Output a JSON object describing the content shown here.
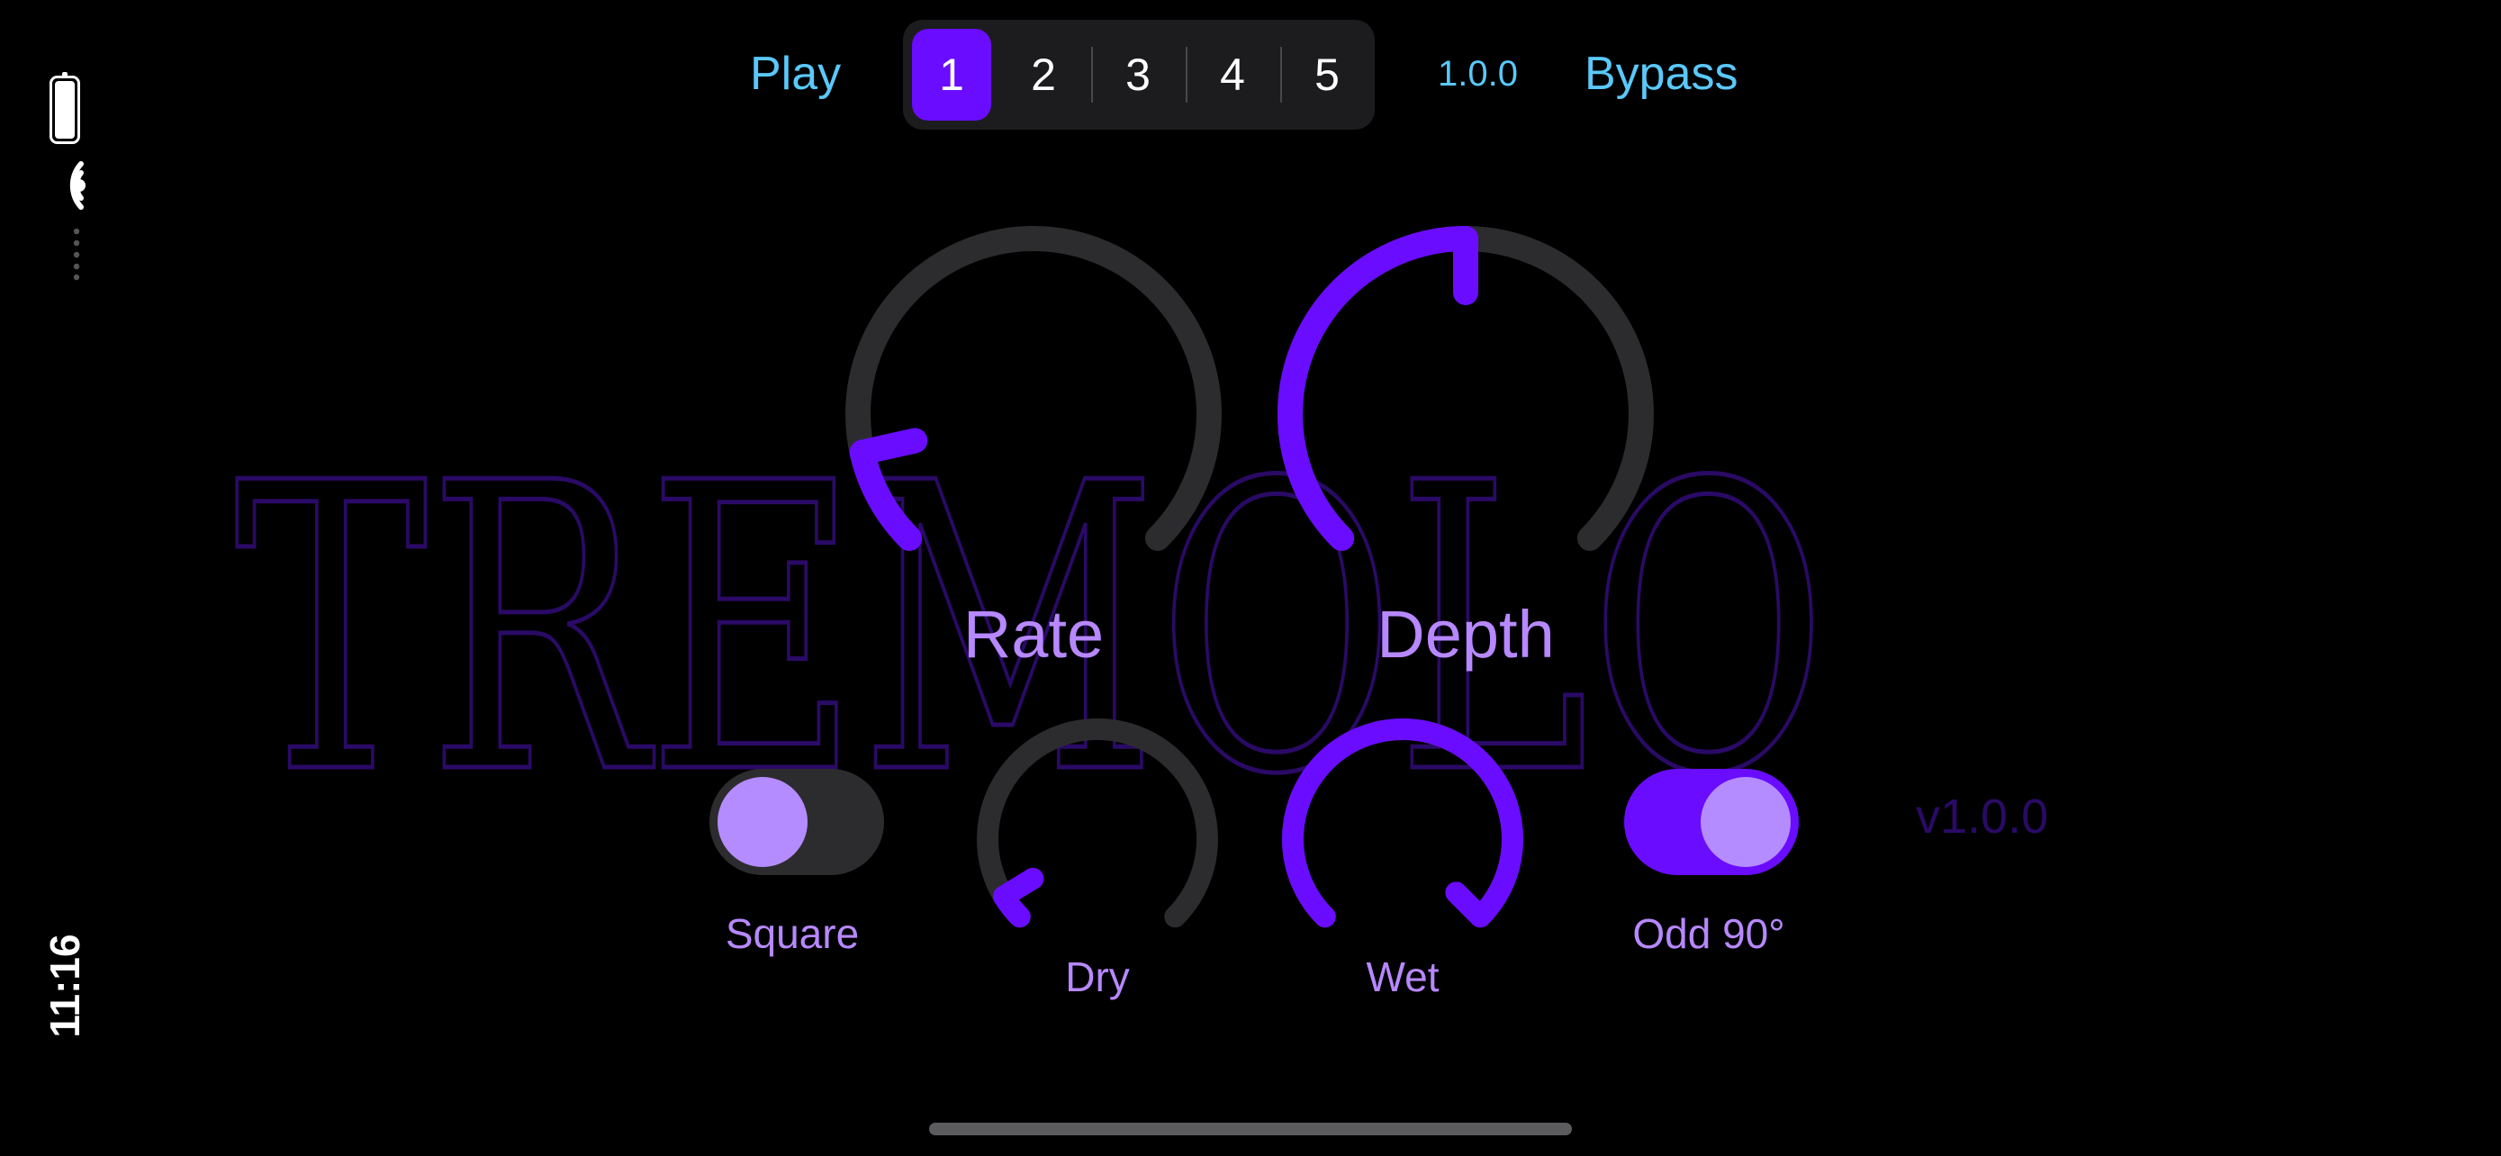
{
  "status_bar": {
    "time": "11:16",
    "battery_icon": "battery-icon",
    "wifi_icon": "wifi-icon"
  },
  "header": {
    "play_label": "Play",
    "bypass_label": "Bypass",
    "version": "1.0.0",
    "presets": [
      {
        "label": "1",
        "selected": true
      },
      {
        "label": "2",
        "selected": false
      },
      {
        "label": "3",
        "selected": false
      },
      {
        "label": "4",
        "selected": false
      },
      {
        "label": "5",
        "selected": false
      }
    ]
  },
  "background": {
    "title": "TREMOLO",
    "version": "v1.0.0"
  },
  "knobs": {
    "rate": {
      "label": "Rate",
      "value": 0.12
    },
    "depth": {
      "label": "Depth",
      "value": 0.5
    },
    "dry": {
      "label": "Dry",
      "value": 0.05
    },
    "wet": {
      "label": "Wet",
      "value": 1.0
    }
  },
  "toggles": {
    "square": {
      "label": "Square",
      "on": false
    },
    "odd90": {
      "label": "Odd 90°",
      "on": true
    }
  },
  "colors": {
    "accent": "#6a0cff",
    "label": "#b788ff",
    "link": "#5ac8fa",
    "track": "#2c2c2e"
  }
}
